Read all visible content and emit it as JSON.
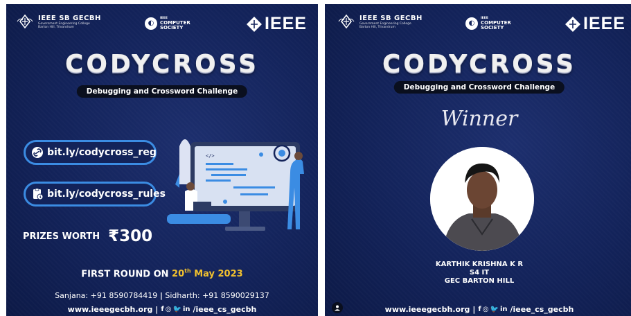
{
  "left_poster": {
    "header": {
      "org_name": "IEEE SB GECBH",
      "org_line1": "Government Engineering College",
      "org_line2": "Barton Hill, Trivandrum",
      "society_small": "IEEE",
      "society_line1": "COMPUTER",
      "society_line2": "SOCIETY",
      "ieee": "IEEE"
    },
    "title": "CODYCROSS",
    "subtitle": "Debugging and Crossword Challenge",
    "links": [
      {
        "label": "bit.ly/codycross_reg",
        "icon": "link-icon"
      },
      {
        "label": "bit.ly/codycross_rules",
        "icon": "clipboard-info-icon"
      }
    ],
    "prizes_label": "PRIZES WORTH",
    "prizes_amount": "₹300",
    "round_prefix": "FIRST ROUND ON",
    "round_day": "20",
    "round_sup": "th",
    "round_month_year": "May 2023",
    "contact_1": "Sanjana: +91 8590784419",
    "contact_sep": "|",
    "contact_2": "Sidharth: +91 8590029137",
    "website": "www.ieeegecbh.org",
    "footer_sep": "|",
    "social_f": "f",
    "social_ig": "◎",
    "social_tw": "🐦",
    "social_in": "in",
    "handle": "/ieee_cs_gecbh",
    "code_tag": "</>"
  },
  "right_poster": {
    "header": {
      "org_name": "IEEE SB GECBH",
      "org_line1": "Government Engineering College",
      "org_line2": "Barton Hill, Trivandrum",
      "society_small": "IEEE",
      "society_line1": "COMPUTER",
      "society_line2": "SOCIETY",
      "ieee": "IEEE"
    },
    "title": "CODYCROSS",
    "subtitle": "Debugging and Crossword Challenge",
    "winner_label": "Winner",
    "winner_name": "KARTHIK KRISHNA K R",
    "winner_class": "S4 IT",
    "winner_college": "GEC BARTON HILL",
    "website": "www.ieeegecbh.org",
    "footer_sep": "|",
    "social_f": "f",
    "social_ig": "◎",
    "social_tw": "🐦",
    "social_in": "in",
    "handle": "/ieee_cs_gecbh"
  },
  "colors": {
    "background": "#13235a",
    "accent_blue": "#3b8ce3",
    "highlight_yellow": "#f2c12e"
  }
}
